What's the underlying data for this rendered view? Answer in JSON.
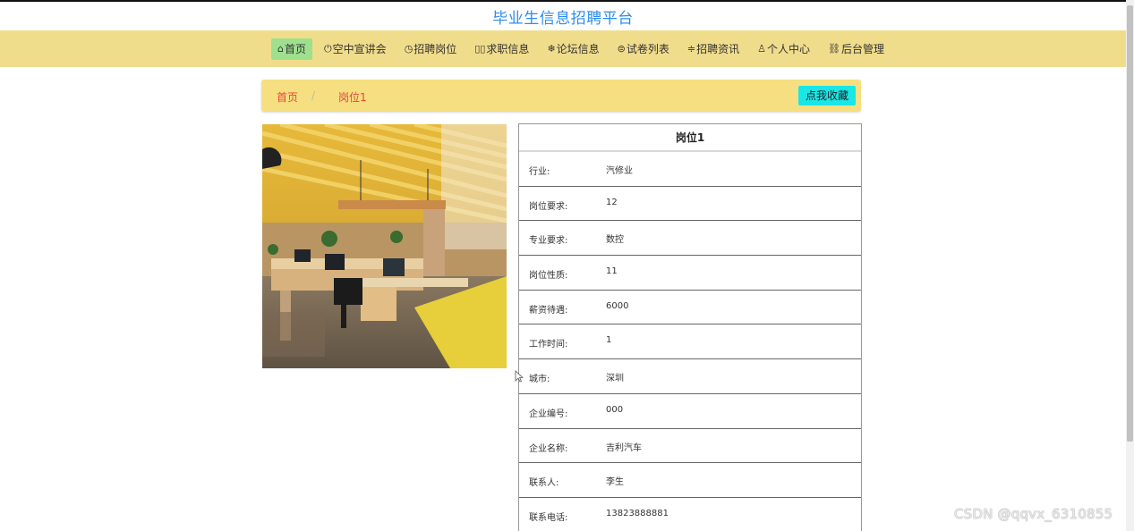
{
  "site_title": "毕业生信息招聘平台",
  "nav": {
    "items": [
      {
        "icon": "⌂",
        "label": "首页"
      },
      {
        "icon": "⏻",
        "label": "空中宣讲会"
      },
      {
        "icon": "◷",
        "label": "招聘岗位"
      },
      {
        "icon": "▯▯",
        "label": "求职信息"
      },
      {
        "icon": "❄",
        "label": "论坛信息"
      },
      {
        "icon": "⊜",
        "label": "试卷列表"
      },
      {
        "icon": "≑",
        "label": "招聘资讯"
      },
      {
        "icon": "♙",
        "label": "个人中心"
      },
      {
        "icon": "⛓",
        "label": "后台管理"
      }
    ],
    "active_index": 0,
    "active_color": "#9ee08e",
    "bar_color": "#f0dd8c"
  },
  "breadcrumb": {
    "home": "首页",
    "separator": "/",
    "current": "岗位1"
  },
  "collect_button": "点我收藏",
  "detail": {
    "title": "岗位1",
    "rows": [
      {
        "label": "行业:",
        "value": "汽修业"
      },
      {
        "label": "岗位要求:",
        "value": "12"
      },
      {
        "label": "专业要求:",
        "value": "数控"
      },
      {
        "label": "岗位性质:",
        "value": "11"
      },
      {
        "label": "薪资待遇:",
        "value": "6000"
      },
      {
        "label": "工作时间:",
        "value": "1"
      },
      {
        "label": "城市:",
        "value": "深圳"
      },
      {
        "label": "企业编号:",
        "value": "000"
      },
      {
        "label": "企业名称:",
        "value": "吉利汽车"
      },
      {
        "label": "联系人:",
        "value": "李生"
      },
      {
        "label": "联系电话:",
        "value": "13823888881"
      }
    ]
  },
  "watermark": "CSDN @qqvx_6310855"
}
